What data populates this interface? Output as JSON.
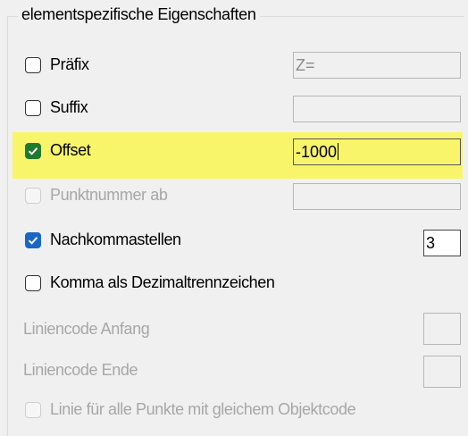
{
  "group": {
    "title": "elementspezifische Eigenschaften"
  },
  "rows": {
    "prefix": {
      "label": "Präfix",
      "checked": false,
      "enabled": true,
      "value": "Z="
    },
    "suffix": {
      "label": "Suffix",
      "checked": false,
      "enabled": true,
      "value": ""
    },
    "offset": {
      "label": "Offset",
      "checked": true,
      "enabled": true,
      "value": "-1000",
      "highlighted": true
    },
    "point_number": {
      "label": "Punktnummer ab",
      "checked": false,
      "enabled": false,
      "value": ""
    },
    "decimals": {
      "label": "Nachkommastellen",
      "checked": true,
      "enabled": true,
      "value": "3"
    },
    "comma": {
      "label": "Komma als Dezimaltrennzeichen",
      "checked": false,
      "enabled": true
    },
    "line_code_start": {
      "label": "Liniencode Anfang",
      "enabled": false,
      "value": ""
    },
    "line_code_end": {
      "label": "Liniencode Ende",
      "enabled": false,
      "value": ""
    },
    "line_all_points": {
      "label": "Linie für alle Punkte mit gleichem Objektcode",
      "checked": false,
      "enabled": false
    }
  },
  "colors": {
    "highlight": "#f8f56a",
    "check_green": "#1e7a2e",
    "check_blue": "#1a66c6"
  }
}
